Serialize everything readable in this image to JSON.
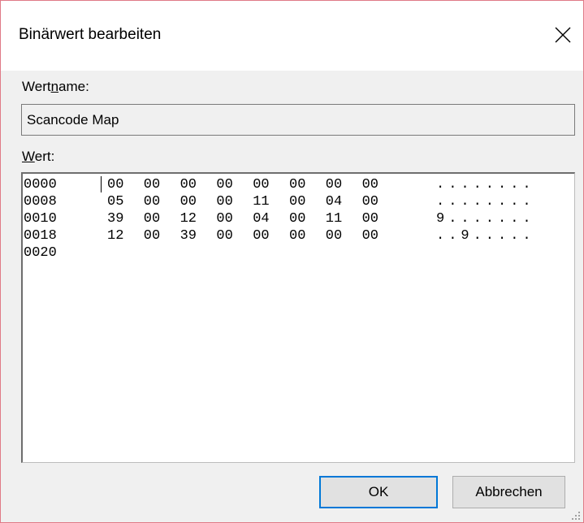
{
  "dialog": {
    "title": "Binärwert bearbeiten",
    "close_icon": "close-icon"
  },
  "value_name": {
    "label_pre": "Wert",
    "label_accel": "n",
    "label_post": "ame:",
    "value": "Scancode Map"
  },
  "value_data": {
    "label_accel": "W",
    "label_post": "ert:",
    "rows": [
      {
        "offset": "0000",
        "bytes": [
          "00",
          "00",
          "00",
          "00",
          "00",
          "00",
          "00",
          "00"
        ],
        "ascii": "........"
      },
      {
        "offset": "0008",
        "bytes": [
          "05",
          "00",
          "00",
          "00",
          "11",
          "00",
          "04",
          "00"
        ],
        "ascii": "........"
      },
      {
        "offset": "0010",
        "bytes": [
          "39",
          "00",
          "12",
          "00",
          "04",
          "00",
          "11",
          "00"
        ],
        "ascii": "9......."
      },
      {
        "offset": "0018",
        "bytes": [
          "12",
          "00",
          "39",
          "00",
          "00",
          "00",
          "00",
          "00"
        ],
        "ascii": "..9....."
      },
      {
        "offset": "0020",
        "bytes": [],
        "ascii": ""
      }
    ]
  },
  "buttons": {
    "ok": "OK",
    "cancel": "Abbrechen"
  },
  "colors": {
    "accent": "#0078d7",
    "window_border": "#e07a87",
    "dialog_bg": "#f0f0f0"
  }
}
